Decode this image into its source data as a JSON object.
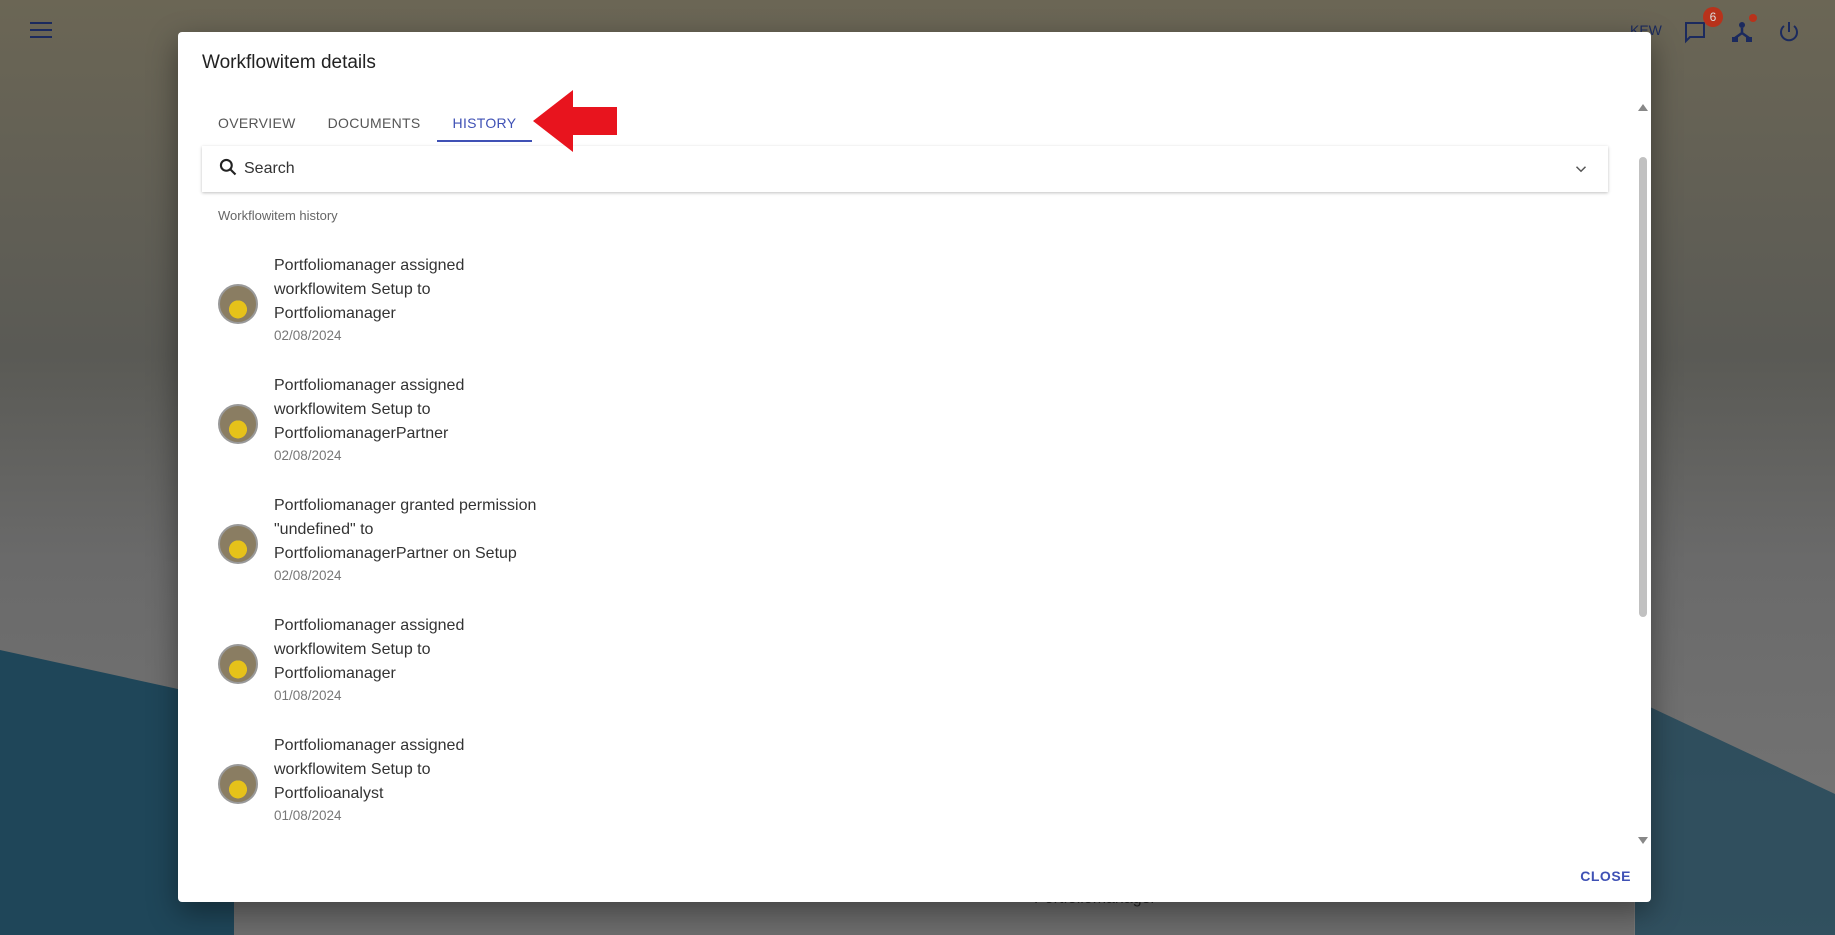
{
  "topbar": {
    "user": "KEW",
    "notifications_count": "6"
  },
  "dialog": {
    "title": "Workflowitem details",
    "tabs": [
      {
        "label": "OVERVIEW"
      },
      {
        "label": "DOCUMENTS"
      },
      {
        "label": "HISTORY",
        "active": true
      }
    ],
    "search_placeholder": "Search",
    "section_label": "Workflowitem history",
    "history": [
      {
        "text": "Portfoliomanager assigned workflowitem Setup to Portfoliomanager",
        "date": "02/08/2024"
      },
      {
        "text": "Portfoliomanager assigned workflowitem Setup to PortfoliomanagerPartner",
        "date": "02/08/2024"
      },
      {
        "text": "Portfoliomanager granted permission \"undefined\" to PortfoliomanagerPartner on Setup",
        "date": "02/08/2024"
      },
      {
        "text": "Portfoliomanager assigned workflowitem Setup to Portfoliomanager",
        "date": "01/08/2024"
      },
      {
        "text": "Portfoliomanager assigned workflowitem Setup to Portfolioanalyst",
        "date": "01/08/2024"
      }
    ],
    "close_label": "CLOSE"
  },
  "background": {
    "assignee_select": "Portfoliomanager"
  },
  "colors": {
    "accent": "#3f51b5",
    "annotation_arrow": "#e8141e",
    "badge": "#b8321b"
  }
}
